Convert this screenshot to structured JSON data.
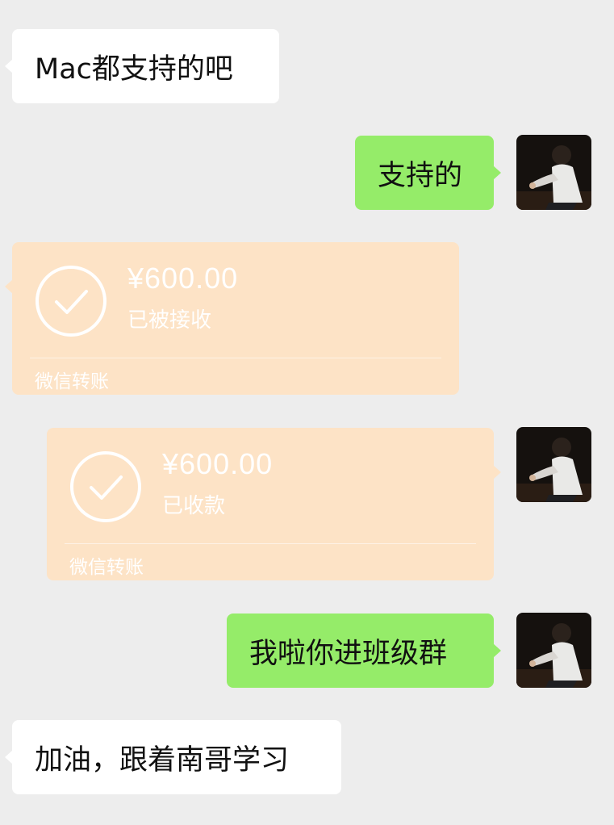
{
  "messages": [
    {
      "text": "Mac都支持的吧"
    },
    {
      "text": "支持的"
    },
    {
      "amount": "¥600.00",
      "status": "已被接收",
      "footer": "微信转账"
    },
    {
      "amount": "¥600.00",
      "status": "已收款",
      "footer": "微信转账"
    },
    {
      "text": "我啦你进班级群"
    },
    {
      "text": "加油，跟着南哥学习"
    }
  ],
  "avatar": {
    "icon": "user-avatar-photo"
  },
  "colors": {
    "background": "#ededed",
    "incoming_bubble": "#ffffff",
    "outgoing_bubble": "#95ec69",
    "transfer_card": "#fde3c6"
  }
}
